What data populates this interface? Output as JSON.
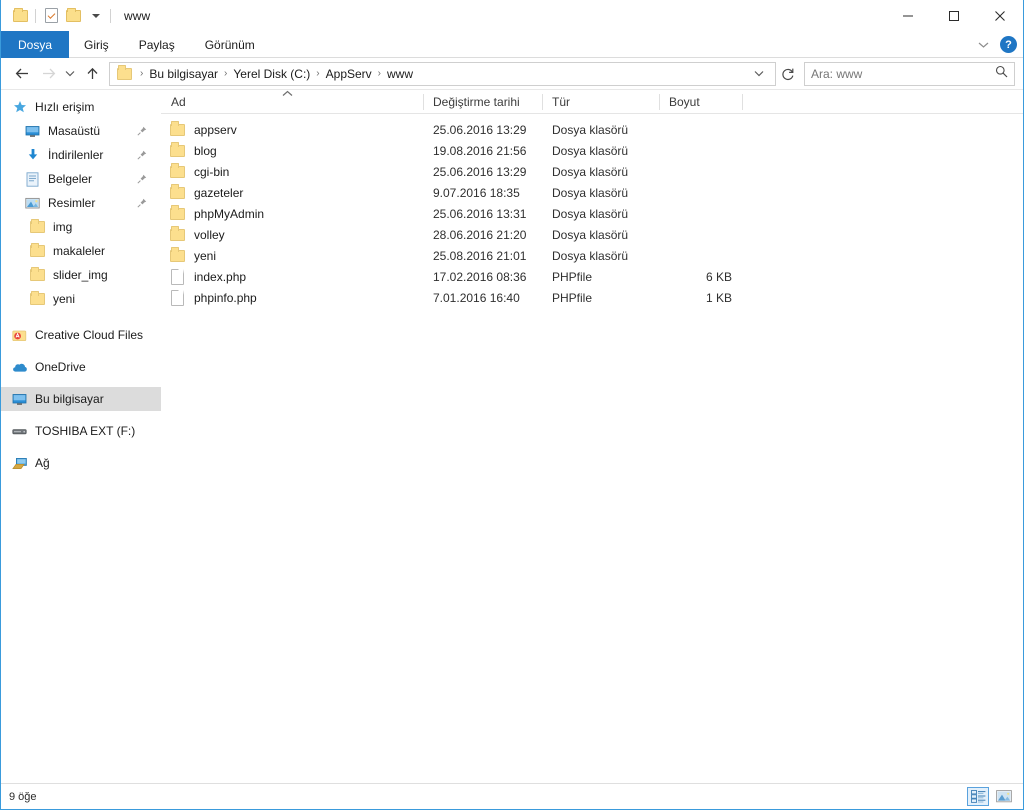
{
  "window": {
    "title": "www",
    "quick_access": [
      "folder-icon",
      "properties-icon",
      "new-folder-icon",
      "customize-caret"
    ],
    "controls": {
      "minimize": "–",
      "maximize": "□",
      "close": "✕"
    }
  },
  "ribbon": {
    "tabs": [
      {
        "label": "Dosya",
        "active": true
      },
      {
        "label": "Giriş",
        "active": false
      },
      {
        "label": "Paylaş",
        "active": false
      },
      {
        "label": "Görünüm",
        "active": false
      }
    ],
    "help_label": "?"
  },
  "address": {
    "crumbs": [
      "Bu bilgisayar",
      "Yerel Disk (C:)",
      "AppServ",
      "www"
    ],
    "separator": "›"
  },
  "search": {
    "placeholder": "Ara: www",
    "value": ""
  },
  "sidebar": {
    "items": [
      {
        "label": "Hızlı erişim",
        "icon": "star-icon",
        "level": 0,
        "pinned": false,
        "selected": false
      },
      {
        "label": "Masaüstü",
        "icon": "desktop-icon",
        "level": 1,
        "pinned": true,
        "selected": false
      },
      {
        "label": "İndirilenler",
        "icon": "downloads-icon",
        "level": 1,
        "pinned": true,
        "selected": false
      },
      {
        "label": "Belgeler",
        "icon": "documents-icon",
        "level": 1,
        "pinned": true,
        "selected": false
      },
      {
        "label": "Resimler",
        "icon": "pictures-icon",
        "level": 1,
        "pinned": true,
        "selected": false
      },
      {
        "label": "img",
        "icon": "folder-icon",
        "level": 1,
        "pinned": false,
        "selected": false
      },
      {
        "label": "makaleler",
        "icon": "folder-icon",
        "level": 1,
        "pinned": false,
        "selected": false
      },
      {
        "label": "slider_img",
        "icon": "folder-icon",
        "level": 1,
        "pinned": false,
        "selected": false
      },
      {
        "label": "yeni",
        "icon": "folder-icon",
        "level": 1,
        "pinned": false,
        "selected": false
      },
      {
        "label": "Creative Cloud Files",
        "icon": "creative-cloud-icon",
        "level": 0,
        "pinned": false,
        "selected": false
      },
      {
        "label": "OneDrive",
        "icon": "onedrive-icon",
        "level": 0,
        "pinned": false,
        "selected": false
      },
      {
        "label": "Bu bilgisayar",
        "icon": "this-pc-icon",
        "level": 0,
        "pinned": false,
        "selected": true
      },
      {
        "label": "TOSHIBA EXT (F:)",
        "icon": "drive-icon",
        "level": 0,
        "pinned": false,
        "selected": false
      },
      {
        "label": "Ağ",
        "icon": "network-icon",
        "level": 0,
        "pinned": false,
        "selected": false
      }
    ]
  },
  "filelist": {
    "columns": [
      "Ad",
      "Değiştirme tarihi",
      "Tür",
      "Boyut"
    ],
    "sort_column": "Ad",
    "sort_direction": "ascending",
    "rows": [
      {
        "name": "appserv",
        "date": "25.06.2016 13:29",
        "type": "Dosya klasörü",
        "size": "",
        "icon": "folder-icon"
      },
      {
        "name": "blog",
        "date": "19.08.2016 21:56",
        "type": "Dosya klasörü",
        "size": "",
        "icon": "folder-icon"
      },
      {
        "name": "cgi-bin",
        "date": "25.06.2016 13:29",
        "type": "Dosya klasörü",
        "size": "",
        "icon": "folder-icon"
      },
      {
        "name": "gazeteler",
        "date": "9.07.2016 18:35",
        "type": "Dosya klasörü",
        "size": "",
        "icon": "folder-icon"
      },
      {
        "name": "phpMyAdmin",
        "date": "25.06.2016 13:31",
        "type": "Dosya klasörü",
        "size": "",
        "icon": "folder-icon"
      },
      {
        "name": "volley",
        "date": "28.06.2016 21:20",
        "type": "Dosya klasörü",
        "size": "",
        "icon": "folder-icon"
      },
      {
        "name": "yeni",
        "date": "25.08.2016 21:01",
        "type": "Dosya klasörü",
        "size": "",
        "icon": "folder-icon"
      },
      {
        "name": "index.php",
        "date": "17.02.2016 08:36",
        "type": "PHPfile",
        "size": "6 KB",
        "icon": "file-icon"
      },
      {
        "name": "phpinfo.php",
        "date": "7.01.2016 16:40",
        "type": "PHPfile",
        "size": "1 KB",
        "icon": "file-icon"
      }
    ]
  },
  "status": {
    "item_count": "9 öğe",
    "views": [
      {
        "name": "details-view",
        "active": true
      },
      {
        "name": "large-icons-view",
        "active": false
      }
    ]
  },
  "colors": {
    "accent": "#1f76c4",
    "folder": "#fcdf8e",
    "selection": "#dcdcdc",
    "window_border": "#3a9bdc"
  }
}
